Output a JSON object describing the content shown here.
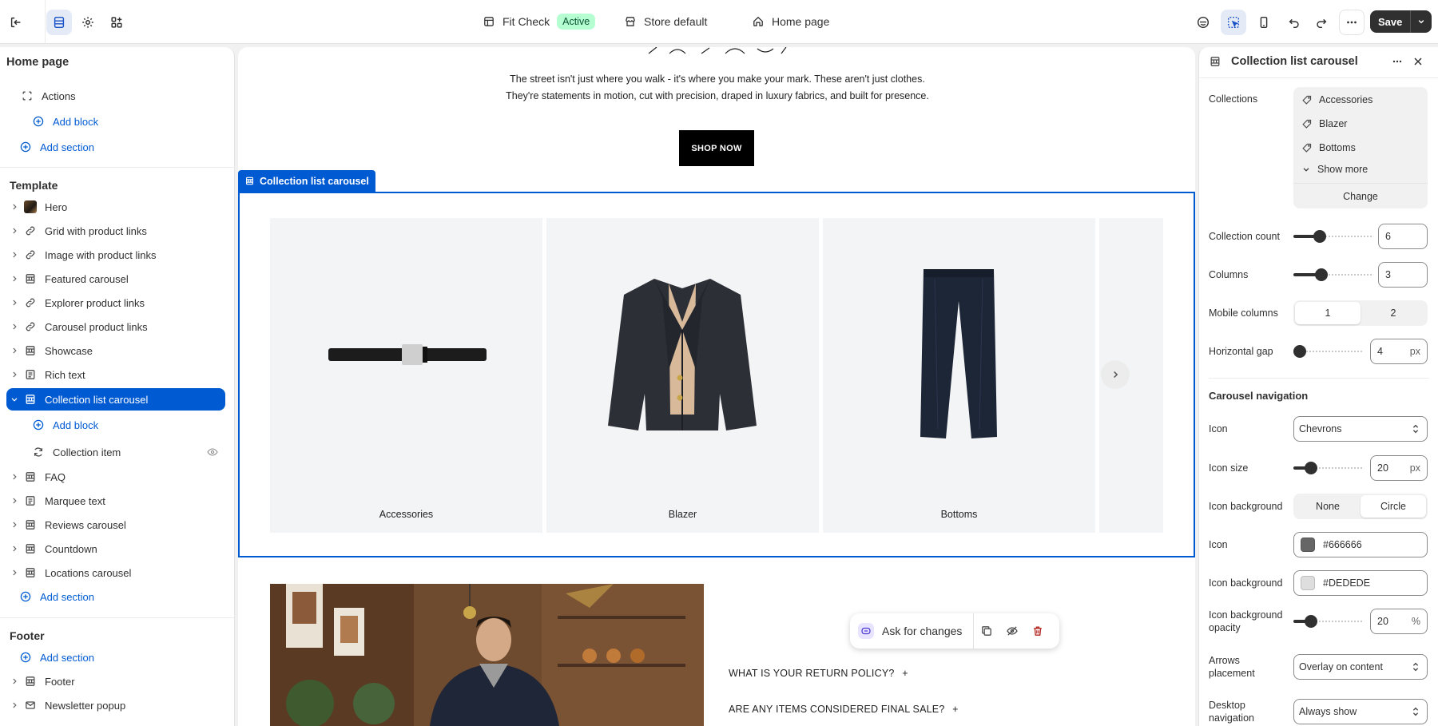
{
  "topbar": {
    "theme_name": "Fit Check",
    "theme_status": "Active",
    "store_context": "Store default",
    "page_context": "Home page",
    "save_label": "Save"
  },
  "sidebar": {
    "title": "Home page",
    "header_rows": [
      {
        "label": "Actions"
      },
      {
        "label": "Add block"
      },
      {
        "label": "Add section"
      }
    ],
    "template_title": "Template",
    "template_items": [
      {
        "label": "Hero"
      },
      {
        "label": "Grid with product links"
      },
      {
        "label": "Image with product links"
      },
      {
        "label": "Featured carousel"
      },
      {
        "label": "Explorer product links"
      },
      {
        "label": "Carousel product links"
      },
      {
        "label": "Showcase"
      },
      {
        "label": "Rich text"
      },
      {
        "label": "Collection list carousel"
      },
      {
        "label": "Add block"
      },
      {
        "label": "Collection item"
      },
      {
        "label": "FAQ"
      },
      {
        "label": "Marquee text"
      },
      {
        "label": "Reviews carousel"
      },
      {
        "label": "Countdown"
      },
      {
        "label": "Locations carousel"
      },
      {
        "label": "Add section"
      }
    ],
    "footer_title": "Footer",
    "footer_items": [
      {
        "label": "Add section"
      },
      {
        "label": "Footer"
      },
      {
        "label": "Newsletter popup"
      }
    ]
  },
  "canvas": {
    "hero_text": "The street isn't just where you walk - it's where you make your mark. These aren't just clothes. They're statements in motion, cut with precision, draped in luxury fabrics, and built for presence.",
    "shop_now": "SHOP NOW",
    "selected_section": "Collection list carousel",
    "collections": [
      {
        "label": "Accessories"
      },
      {
        "label": "Blazer"
      },
      {
        "label": "Bottoms"
      }
    ],
    "faq": [
      {
        "q": "WHAT IS YOUR RETURN POLICY?",
        "icon": "+"
      },
      {
        "q": "ARE ANY ITEMS CONSIDERED FINAL SALE?",
        "icon": "+"
      }
    ],
    "ask_label": "Ask for changes"
  },
  "inspector": {
    "title": "Collection list carousel",
    "collections_label": "Collections",
    "collection_items": [
      "Accessories",
      "Blazer",
      "Bottoms"
    ],
    "show_more": "Show more",
    "change": "Change",
    "collection_count_label": "Collection count",
    "collection_count": "6",
    "collection_count_level": 0.3,
    "columns_label": "Columns",
    "columns": "3",
    "columns_level": 0.33,
    "mobile_columns_label": "Mobile columns",
    "mobile_options": [
      "1",
      "2"
    ],
    "mobile_selected": "1",
    "horizontal_gap_label": "Horizontal gap",
    "horizontal_gap": "4",
    "horizontal_gap_level": 0.0,
    "px_unit": "px",
    "carousel_nav_title": "Carousel navigation",
    "icon_label": "Icon",
    "icon_value": "Chevrons",
    "icon_size_label": "Icon size",
    "icon_size": "20",
    "icon_size_level": 0.2,
    "icon_background_label": "Icon background",
    "icon_bg_options": [
      "None",
      "Circle"
    ],
    "icon_bg_selected": "Circle",
    "icon_color_label": "Icon",
    "icon_color": "#666666",
    "icon_bg_color_label": "Icon background",
    "icon_bg_color": "#DEDEDE",
    "icon_bg_opacity_label": "Icon background opacity",
    "icon_bg_opacity": "20",
    "icon_bg_opacity_level": 0.2,
    "percent_unit": "%",
    "arrows_placement_label": "Arrows placement",
    "arrows_placement": "Overlay on content",
    "desktop_nav_label": "Desktop navigation",
    "desktop_nav": "Always show"
  },
  "colors": {
    "accent": "#005bd3",
    "save_bg": "#303030",
    "active_badge": "#b4fed2"
  }
}
